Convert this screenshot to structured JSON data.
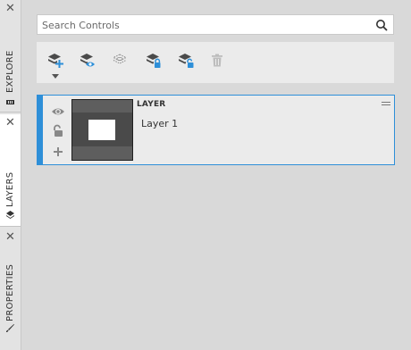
{
  "tabs": [
    {
      "label": "EXPLORE",
      "icon": "book-icon"
    },
    {
      "label": "LAYERS",
      "icon": "layers-icon"
    },
    {
      "label": "PROPERTIES",
      "icon": "brush-icon"
    }
  ],
  "search": {
    "placeholder": "Search Controls"
  },
  "toolbar": {
    "buttons": [
      "add-layer",
      "show-layer",
      "hide-layer",
      "lock-layer",
      "unlock-layer",
      "delete-layer"
    ]
  },
  "layer": {
    "type_label": "LAYER",
    "name": "Layer 1"
  },
  "colors": {
    "accent": "#2e8fd8",
    "icon_dark": "#4a4a4a",
    "icon_disabled": "#bdbdbd"
  }
}
